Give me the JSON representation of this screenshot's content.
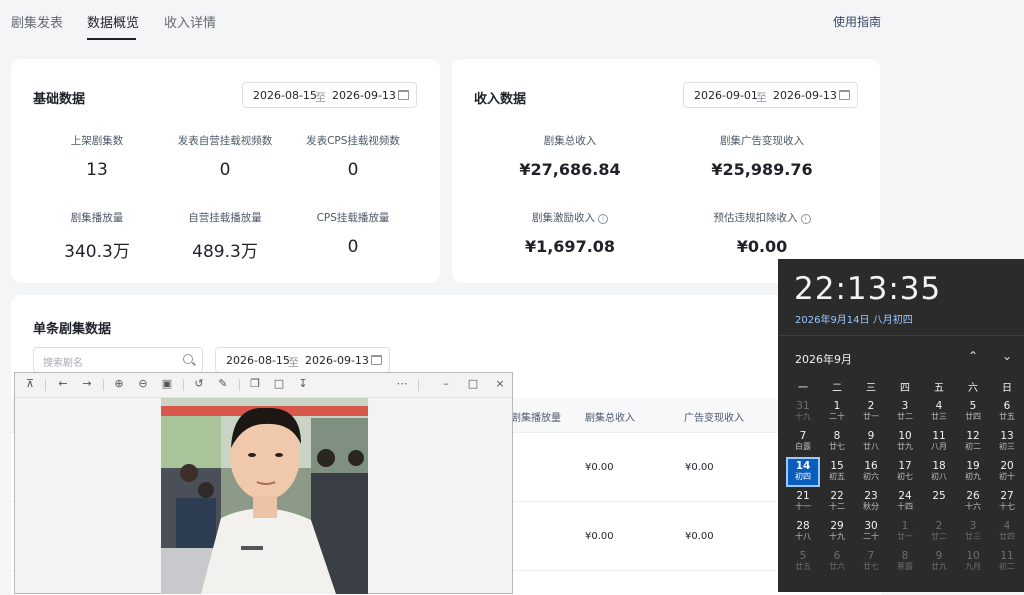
{
  "tabs": [
    {
      "label": "剧集发表",
      "active": false
    },
    {
      "label": "数据概览",
      "active": true
    },
    {
      "label": "收入详情",
      "active": false
    }
  ],
  "guide_link": "使用指南",
  "basic": {
    "title": "基础数据",
    "date_from": "2026-08-15",
    "date_to": "2026-09-13",
    "sep": "至",
    "metrics": [
      {
        "label": "上架剧集数",
        "value": "13"
      },
      {
        "label": "发表自营挂载视频数",
        "value": "0"
      },
      {
        "label": "发表CPS挂载视频数",
        "value": "0"
      },
      {
        "label": "剧集播放量",
        "value": "340.3万"
      },
      {
        "label": "自营挂载播放量",
        "value": "489.3万"
      },
      {
        "label": "CPS挂载播放量",
        "value": "0"
      }
    ]
  },
  "income": {
    "title": "收入数据",
    "date_from": "2026-09-01",
    "date_to": "2026-09-13",
    "sep": "至",
    "metrics": [
      {
        "label": "剧集总收入",
        "value": "¥27,686.84"
      },
      {
        "label": "剧集广告变现收入",
        "value": "¥25,989.76"
      },
      {
        "label": "剧集激励收入",
        "value": "¥1,697.08"
      },
      {
        "label": "预估违规扣除收入",
        "value": "¥0.00"
      }
    ]
  },
  "single": {
    "title": "单条剧集数据",
    "search_placeholder": "搜索剧名",
    "date_from": "2026-08-15",
    "date_to": "2026-09-13",
    "sep": "至",
    "columns": [
      "剧集播放量",
      "剧集总收入",
      "广告变现收入"
    ],
    "rows": [
      {
        "total": "¥0.00",
        "ad": "¥0.00"
      },
      {
        "total": "¥0.00",
        "ad": "¥0.00"
      }
    ]
  },
  "viewer": {
    "icons": [
      "pin-icon",
      "back-icon",
      "forward-icon",
      "zoom-in-icon",
      "zoom-out-icon",
      "fit-icon",
      "rotate-icon",
      "edit-icon",
      "copy-icon",
      "crop-icon",
      "save-icon",
      "more-icon",
      "minimize-icon",
      "maximize-icon",
      "close-icon"
    ]
  },
  "flyout": {
    "time": "22:13:35",
    "date_line": "2026年9月14日 八月初四",
    "month": "2026年9月",
    "weekdays": [
      "一",
      "二",
      "三",
      "四",
      "五",
      "六",
      "日"
    ],
    "weeks": [
      [
        [
          "31",
          "十九",
          1
        ],
        [
          "1",
          "二十",
          0
        ],
        [
          "2",
          "廿一",
          0
        ],
        [
          "3",
          "廿二",
          0
        ],
        [
          "4",
          "廿三",
          0
        ],
        [
          "5",
          "廿四",
          0
        ],
        [
          "6",
          "廿五",
          0
        ]
      ],
      [
        [
          "7",
          "白露",
          0
        ],
        [
          "8",
          "廿七",
          0
        ],
        [
          "9",
          "廿八",
          0
        ],
        [
          "10",
          "廿九",
          0
        ],
        [
          "11",
          "八月",
          0
        ],
        [
          "12",
          "初二",
          0
        ],
        [
          "13",
          "初三",
          0
        ]
      ],
      [
        [
          "14",
          "初四",
          2
        ],
        [
          "15",
          "初五",
          0
        ],
        [
          "16",
          "初六",
          0
        ],
        [
          "17",
          "初七",
          0
        ],
        [
          "18",
          "初八",
          0
        ],
        [
          "19",
          "初九",
          0
        ],
        [
          "20",
          "初十",
          0
        ]
      ],
      [
        [
          "21",
          "十一",
          0
        ],
        [
          "22",
          "十二",
          0
        ],
        [
          "23",
          "秋分",
          0
        ],
        [
          "24",
          "十四",
          0
        ],
        [
          "25",
          "",
          0
        ],
        [
          "26",
          "十六",
          0
        ],
        [
          "27",
          "十七",
          0
        ]
      ],
      [
        [
          "28",
          "十八",
          0
        ],
        [
          "29",
          "十九",
          0
        ],
        [
          "30",
          "二十",
          0
        ],
        [
          "1",
          "廿一",
          1
        ],
        [
          "2",
          "廿二",
          1
        ],
        [
          "3",
          "廿三",
          1
        ],
        [
          "4",
          "廿四",
          1
        ]
      ],
      [
        [
          "5",
          "廿五",
          1
        ],
        [
          "6",
          "廿六",
          1
        ],
        [
          "7",
          "廿七",
          1
        ],
        [
          "8",
          "寒露",
          1
        ],
        [
          "9",
          "廿九",
          1
        ],
        [
          "10",
          "九月",
          1
        ],
        [
          "11",
          "初二",
          1
        ]
      ]
    ]
  },
  "colors": {
    "accent": "#0a5cbd",
    "flyout_bg": "#2b2b2b",
    "link": "#99c8ff"
  }
}
